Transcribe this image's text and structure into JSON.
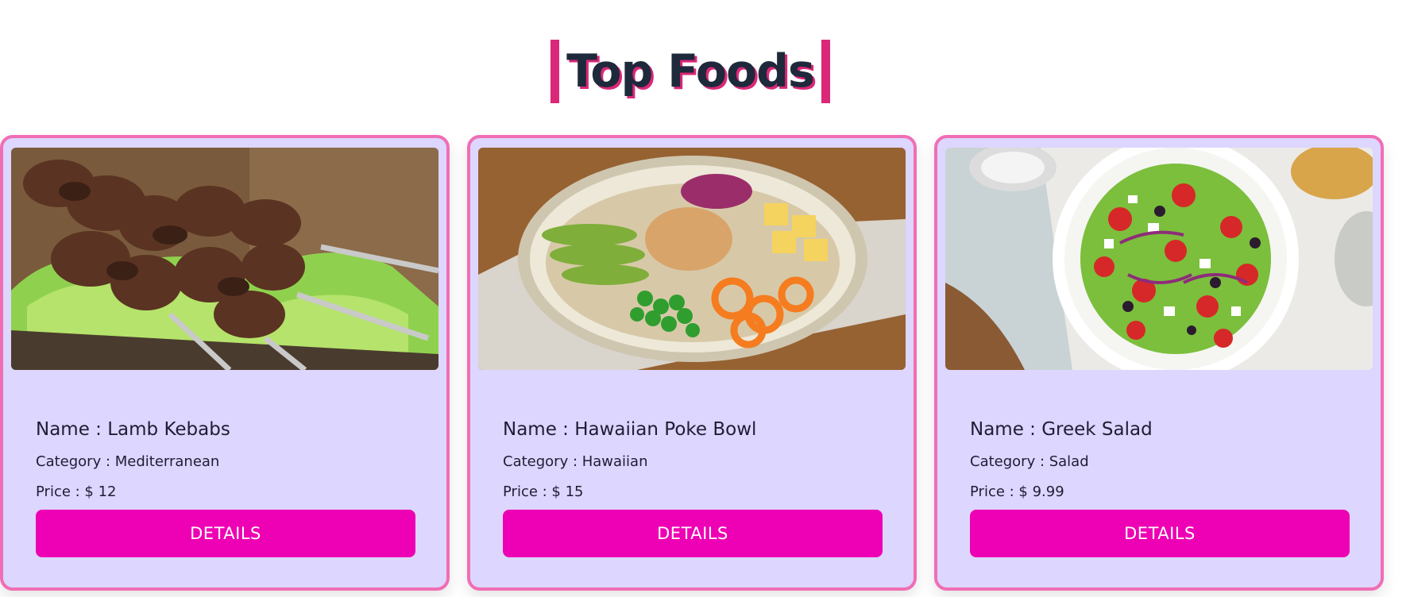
{
  "section": {
    "title": "Top Foods"
  },
  "colors": {
    "accent": "#db2777",
    "card_bg": "#ddd6fe",
    "card_border": "#f06eb4",
    "button": "#ee00b4"
  },
  "cards": [
    {
      "image_desc": "lamb-kebabs-photo",
      "name": "Name : Lamb Kebabs",
      "category": "Category : Mediterranean",
      "price": "Price : $ 12",
      "button_label": "DETAILS"
    },
    {
      "image_desc": "poke-bowl-photo",
      "name": "Name : Hawaiian Poke Bowl",
      "category": "Category : Hawaiian",
      "price": "Price : $ 15",
      "button_label": "DETAILS"
    },
    {
      "image_desc": "greek-salad-photo",
      "name": "Name : Greek Salad",
      "category": "Category : Salad",
      "price": "Price : $ 9.99",
      "button_label": "DETAILS"
    }
  ]
}
